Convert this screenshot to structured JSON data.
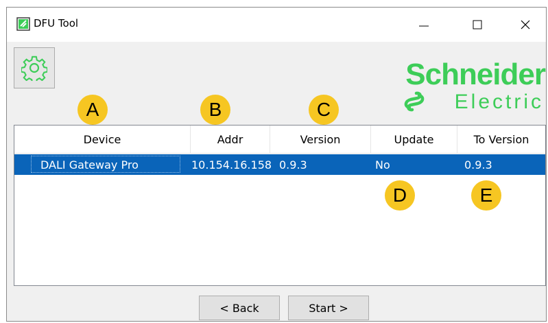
{
  "window": {
    "title": "DFU Tool",
    "controls": {
      "minimize": "—",
      "maximize": "☐",
      "close": "✕"
    }
  },
  "brand": {
    "name": "Schneider",
    "sub": "Electric",
    "color": "#3dcd58"
  },
  "toolbar": {
    "settings_icon": "gear-icon"
  },
  "markers": [
    "A",
    "B",
    "C",
    "D",
    "E"
  ],
  "table": {
    "columns": [
      "Device",
      "Addr",
      "Version",
      "Update",
      "To Version"
    ],
    "rows": [
      {
        "device": "DALI Gateway Pro",
        "addr": "10.154.16.158",
        "version": "0.9.3",
        "update": "No",
        "to_version": "0.9.3"
      }
    ],
    "selected_row_color": "#0a64b9"
  },
  "buttons": {
    "back": "< Back",
    "start": "Start >"
  },
  "marker_color": "#f6c622"
}
